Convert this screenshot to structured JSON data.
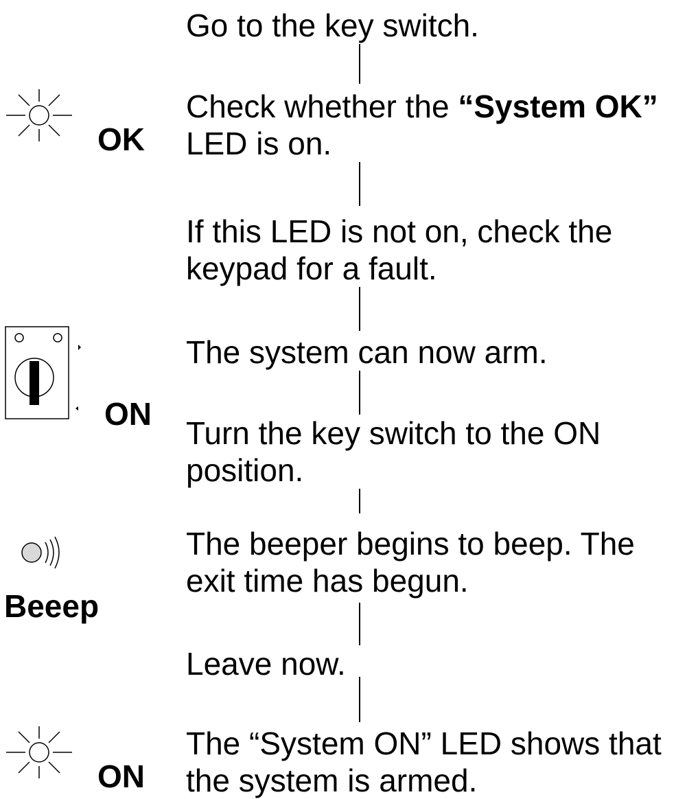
{
  "steps": [
    {
      "id": "go-to-key-switch",
      "lines": [
        "Go to the key switch."
      ]
    },
    {
      "id": "check-system-ok",
      "line1_before": "Check whether the ",
      "line1_bold": "“System OK”",
      "line2": "LED is on."
    },
    {
      "id": "led-not-on",
      "lines": [
        "If this LED is not on, check the",
        "keypad for a fault."
      ]
    },
    {
      "id": "system-can-arm",
      "lines": [
        "The system can now arm."
      ]
    },
    {
      "id": "turn-key",
      "lines": [
        "Turn the key switch to the ON",
        "position."
      ]
    },
    {
      "id": "beeper",
      "lines": [
        "The beeper begins to beep. The",
        "exit time has begun."
      ]
    },
    {
      "id": "leave-now",
      "lines": [
        "Leave now."
      ]
    },
    {
      "id": "system-on",
      "lines": [
        "The “System ON” LED shows that",
        "the system is armed."
      ]
    }
  ],
  "side_labels": {
    "ok": "OK",
    "on_key": "ON",
    "beeep": "Beeep",
    "on_led": "ON"
  },
  "icons": {
    "led_ok": "led-lit-icon",
    "key_switch": "key-switch-icon",
    "beeper": "beeper-icon",
    "led_on": "led-lit-icon"
  }
}
